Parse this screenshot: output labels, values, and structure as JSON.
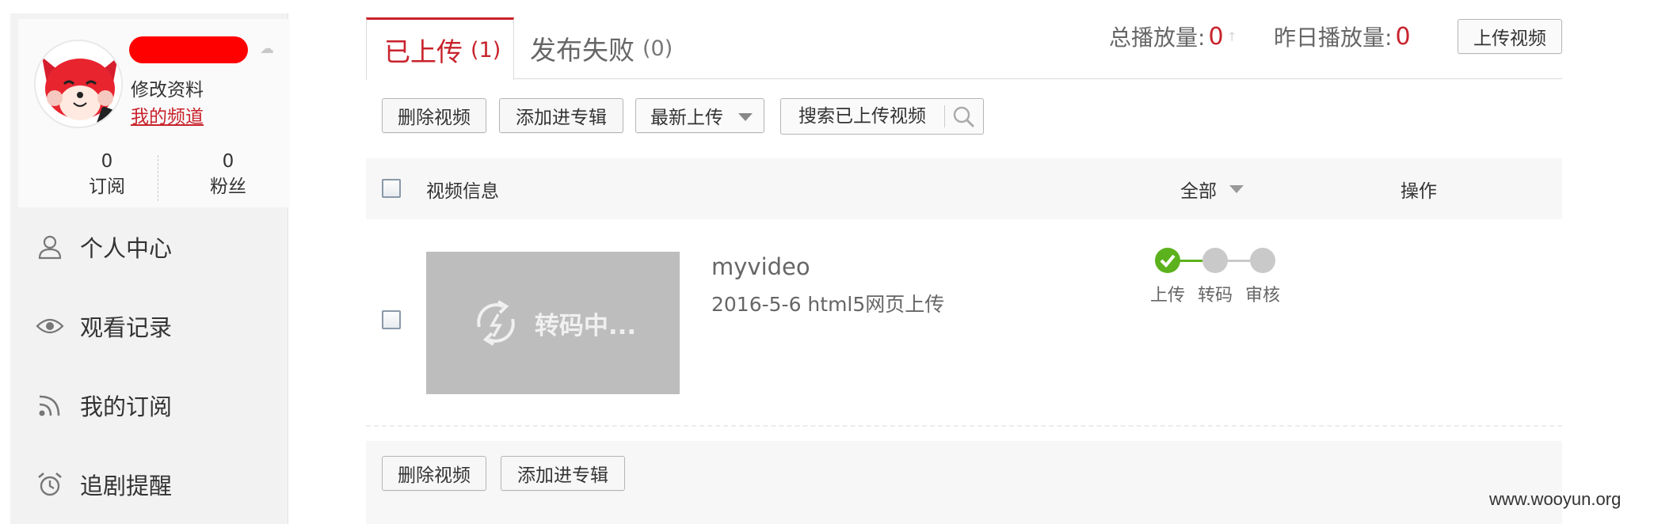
{
  "sidebar": {
    "profile": {
      "edit_profile": "修改资料",
      "my_channel": "我的频道",
      "subscriptions": {
        "count": "0",
        "label": "订阅"
      },
      "fans": {
        "count": "0",
        "label": "粉丝"
      }
    },
    "nav": [
      {
        "label": "个人中心",
        "icon": "user-icon"
      },
      {
        "label": "观看记录",
        "icon": "eye-icon"
      },
      {
        "label": "我的订阅",
        "icon": "rss-icon"
      },
      {
        "label": "追剧提醒",
        "icon": "alarm-clock-icon"
      }
    ]
  },
  "tabs": [
    {
      "label": "已上传",
      "count": "(1)",
      "active": true
    },
    {
      "label": "发布失败",
      "count": "(0)",
      "active": false
    }
  ],
  "stats": {
    "total_label": "总播放量:",
    "total_value": "0",
    "yesterday_label": "昨日播放量:",
    "yesterday_value": "0"
  },
  "upload_button": "上传视频",
  "toolbar": {
    "delete": "删除视频",
    "add_to_album": "添加进专辑",
    "sort_selected": "最新上传",
    "search_placeholder": "搜索已上传视频"
  },
  "table": {
    "headers": {
      "info": "视频信息",
      "filter": "全部",
      "action": "操作"
    },
    "rows": [
      {
        "thumbnail_text": "转码中...",
        "title": "myvideo",
        "meta": "2016-5-6 html5网页上传",
        "steps": [
          {
            "label": "上传",
            "done": true
          },
          {
            "label": "转码",
            "done": false
          },
          {
            "label": "审核",
            "done": false
          }
        ]
      }
    ]
  },
  "footer": {
    "delete": "删除视频",
    "add_to_album": "添加进专辑"
  },
  "watermark": "www.wooyun.org",
  "colors": {
    "accent": "#c8232c",
    "success": "#5cb21d"
  }
}
